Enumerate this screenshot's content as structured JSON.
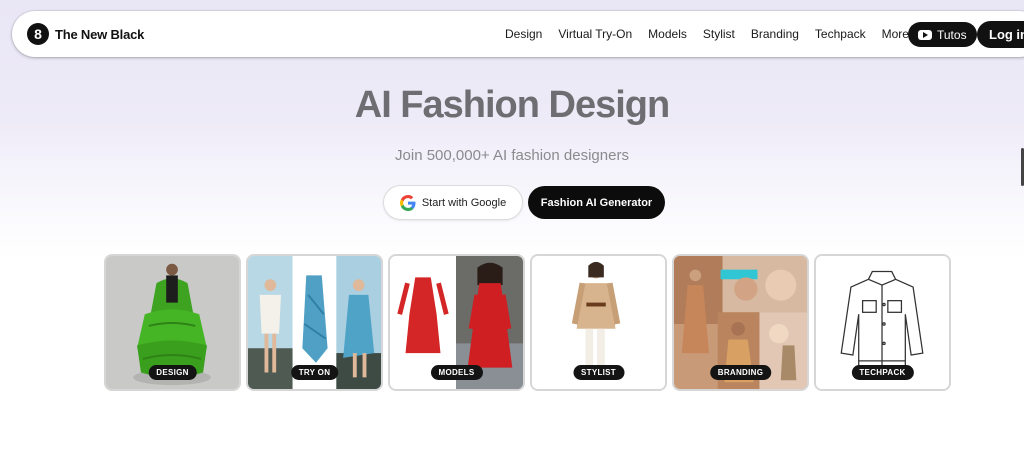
{
  "brand": {
    "logo_glyph": "8",
    "name": "The New Black"
  },
  "nav": {
    "links": [
      "Design",
      "Virtual Try-On",
      "Models",
      "Stylist",
      "Branding",
      "Techpack"
    ],
    "more_label": "More",
    "tutos_label": "Tutos",
    "login_label": "Log in"
  },
  "hero": {
    "title": "AI Fashion Design",
    "subtitle": "Join 500,000+ AI fashion designers",
    "google_button": "Start with Google",
    "generator_button": "Fashion AI Generator"
  },
  "cards": [
    {
      "label": "DESIGN"
    },
    {
      "label": "TRY ON"
    },
    {
      "label": "MODELS"
    },
    {
      "label": "STYLIST"
    },
    {
      "label": "BRANDING"
    },
    {
      "label": "TECHPACK"
    }
  ],
  "colors": {
    "accent_dark": "#111111",
    "title_gray": "#6e6e72",
    "hero_bg": "#e9e6f6"
  }
}
